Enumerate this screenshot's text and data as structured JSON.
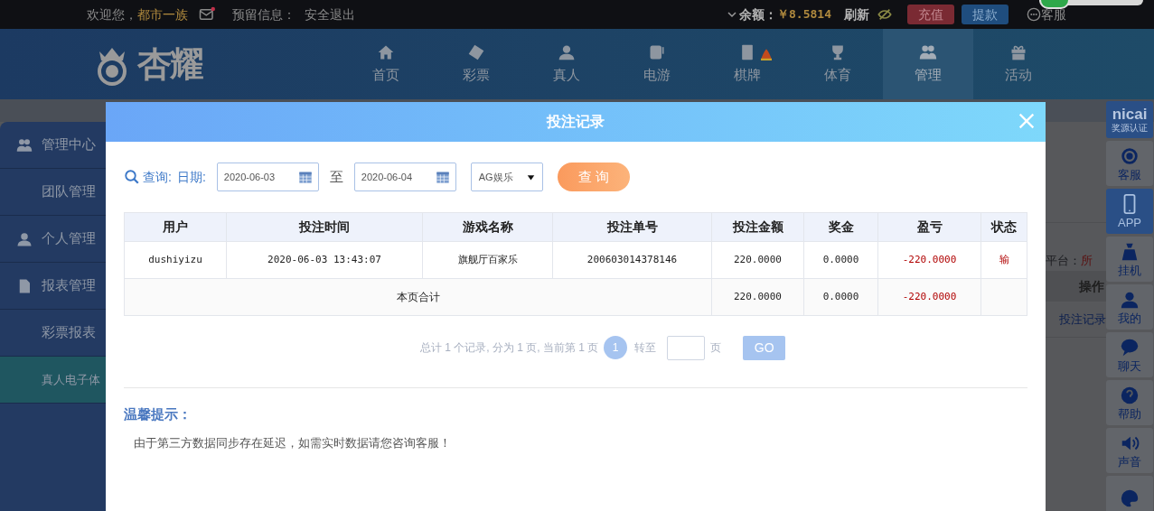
{
  "top_bar": {
    "welcome": "欢迎您，",
    "username": "都市一族",
    "mail_unread": true,
    "reserved_info": "预留信息：",
    "logout": "安全退出",
    "balance_label": "余额：",
    "balance": "￥8.5814",
    "refresh": "刷新",
    "deposit": "充值",
    "withdraw": "提款",
    "service": "客服"
  },
  "logo": {
    "text": "杏耀"
  },
  "nav": {
    "items": [
      {
        "label": "首页",
        "selected": false
      },
      {
        "label": "彩票",
        "selected": false
      },
      {
        "label": "真人",
        "selected": false
      },
      {
        "label": "电游",
        "selected": false
      },
      {
        "label": "棋牌",
        "selected": false,
        "badge": true
      },
      {
        "label": "体育",
        "selected": false
      },
      {
        "label": "管理",
        "selected": true
      },
      {
        "label": "活动",
        "selected": false
      }
    ]
  },
  "sidebar": {
    "items": [
      {
        "label": "管理中心",
        "kind": "group",
        "selected": false
      },
      {
        "label": "团队管理",
        "kind": "item",
        "selected": false
      },
      {
        "label": "个人管理",
        "kind": "group",
        "selected": false
      },
      {
        "label": "报表管理",
        "kind": "group",
        "selected": false
      },
      {
        "label": "彩票报表",
        "kind": "item",
        "selected": false
      },
      {
        "label": "真人电子体",
        "kind": "item",
        "selected": true
      }
    ]
  },
  "background_page": {
    "platform_label": "平台：",
    "platform_value": "所",
    "column_header": "操作",
    "link": "投注记录"
  },
  "right_toolbar": {
    "items": [
      {
        "label": "nicai",
        "sublabel": "奖源认证",
        "kind": "logo",
        "selected": false
      },
      {
        "label": "客服",
        "kind": "button",
        "selected": false
      },
      {
        "label": "APP",
        "kind": "button",
        "selected": true
      },
      {
        "label": "挂机",
        "kind": "button",
        "selected": false
      },
      {
        "label": "我的",
        "kind": "button",
        "selected": false
      },
      {
        "label": "聊天",
        "kind": "button",
        "selected": false
      },
      {
        "label": "帮助",
        "kind": "button",
        "selected": false
      },
      {
        "label": "声音",
        "kind": "button",
        "selected": false
      },
      {
        "kind": "button",
        "selected": false
      }
    ]
  },
  "modal": {
    "title": "投注记录",
    "query": {
      "label": "查询:",
      "date_label": "日期:",
      "start_date": "2020-06-03",
      "separator": "至",
      "end_date": "2020-06-04",
      "platform": "AG娱乐",
      "button": "查 询"
    },
    "table": {
      "columns": [
        {
          "label": "用户",
          "highlight": false
        },
        {
          "label": "投注时间",
          "highlight": false
        },
        {
          "label": "游戏名称",
          "highlight": false
        },
        {
          "label": "投注单号",
          "highlight": false
        },
        {
          "label": "投注金额",
          "highlight": false
        },
        {
          "label": "奖金",
          "highlight": false
        },
        {
          "label": "盈亏",
          "highlight": true
        },
        {
          "label": "状态",
          "highlight": true
        }
      ],
      "rows": [
        [
          "dushiyizu",
          "2020-06-03 13:43:07",
          "旗舰厅百家乐",
          "200603014378146",
          "220.0000",
          "0.0000",
          "-220.0000",
          "输"
        ]
      ],
      "summary": {
        "label": "本页合计",
        "values": [
          "220.0000",
          "0.0000",
          "-220.0000"
        ]
      }
    },
    "pagination": {
      "summary": "总计 1 个记录, 分为 1 页, 当前第 1 页",
      "pages": [
        {
          "label": "1",
          "selected": true
        }
      ],
      "goto_label": "转至",
      "page_unit": "页",
      "go": "GO"
    },
    "tip_title": "温馨提示：",
    "tip_text": "由于第三方数据同步存在延迟，如需实时数据请您咨询客服！"
  }
}
